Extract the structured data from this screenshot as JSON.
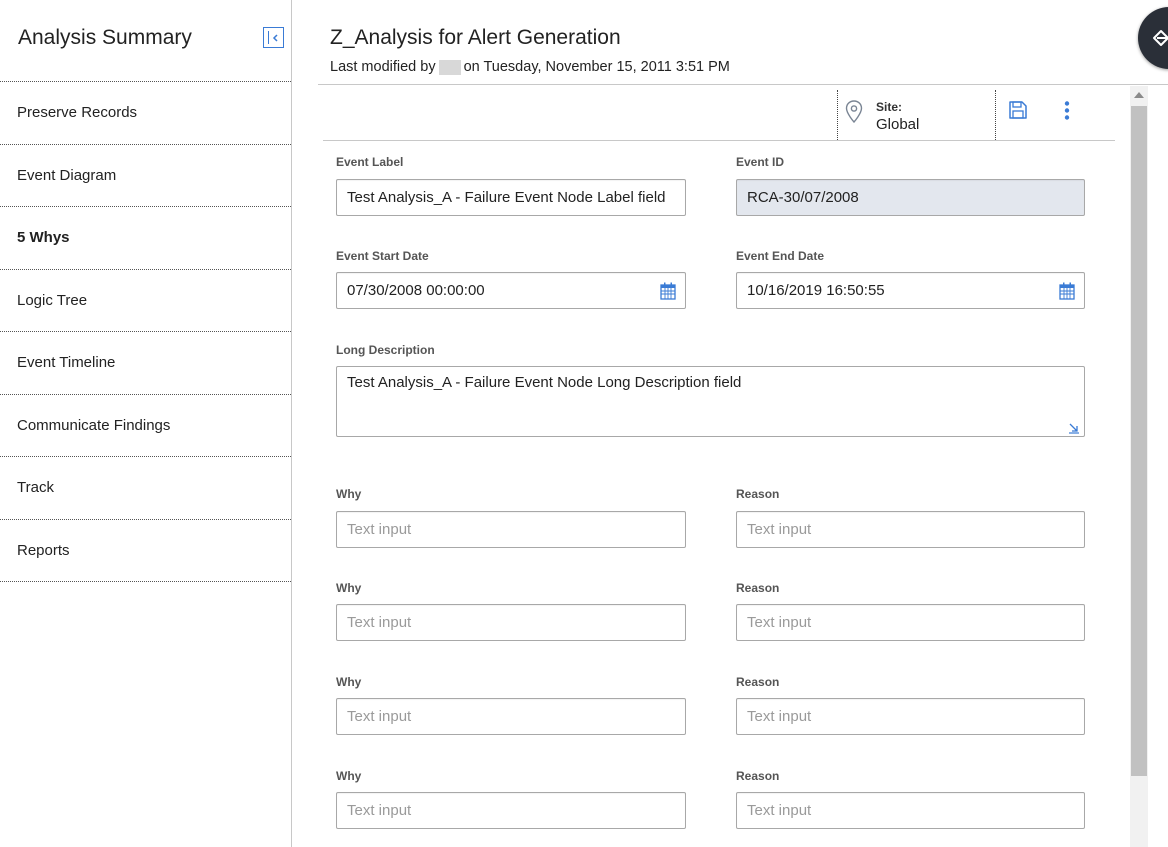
{
  "sidebar": {
    "title": "Analysis Summary",
    "items": [
      {
        "label": "Preserve Records"
      },
      {
        "label": "Event Diagram"
      },
      {
        "label": "5 Whys",
        "active": true
      },
      {
        "label": "Logic Tree"
      },
      {
        "label": "Event Timeline"
      },
      {
        "label": "Communicate Findings"
      },
      {
        "label": "Track"
      },
      {
        "label": "Reports"
      }
    ]
  },
  "header": {
    "title": "Z_Analysis for Alert Generation",
    "modified_prefix": "Last modified by",
    "modified_suffix": "on Tuesday, November 15, 2011 3:51 PM"
  },
  "toolbar": {
    "site_label": "Site:",
    "site_value": "Global"
  },
  "form": {
    "event_label": {
      "label": "Event Label",
      "value": "Test Analysis_A  - Failure Event Node Label field"
    },
    "event_id": {
      "label": "Event ID",
      "value": "RCA-30/07/2008"
    },
    "event_start": {
      "label": "Event Start Date",
      "value": "07/30/2008 00:00:00"
    },
    "event_end": {
      "label": "Event End Date",
      "value": "10/16/2019 16:50:55"
    },
    "long_description": {
      "label": "Long Description",
      "value": "Test Analysis_A  - Failure Event Node Long Description field"
    },
    "whys": [
      {
        "why_label": "Why",
        "reason_label": "Reason",
        "why_placeholder": "Text input",
        "reason_placeholder": "Text input"
      },
      {
        "why_label": "Why",
        "reason_label": "Reason",
        "why_placeholder": "Text input",
        "reason_placeholder": "Text input"
      },
      {
        "why_label": "Why",
        "reason_label": "Reason",
        "why_placeholder": "Text input",
        "reason_placeholder": "Text input"
      },
      {
        "why_label": "Why",
        "reason_label": "Reason",
        "why_placeholder": "Text input",
        "reason_placeholder": "Text input"
      }
    ]
  },
  "colors": {
    "accent": "#3a7bd5",
    "readonly_bg": "#e3e7ee",
    "float_button": "#2a2f38"
  },
  "icons": {
    "collapse": "collapse-sidebar-icon",
    "site": "location-pin-icon",
    "save": "save-icon",
    "more": "more-vertical-icon",
    "calendar": "calendar-icon",
    "float": "exit-icon"
  }
}
